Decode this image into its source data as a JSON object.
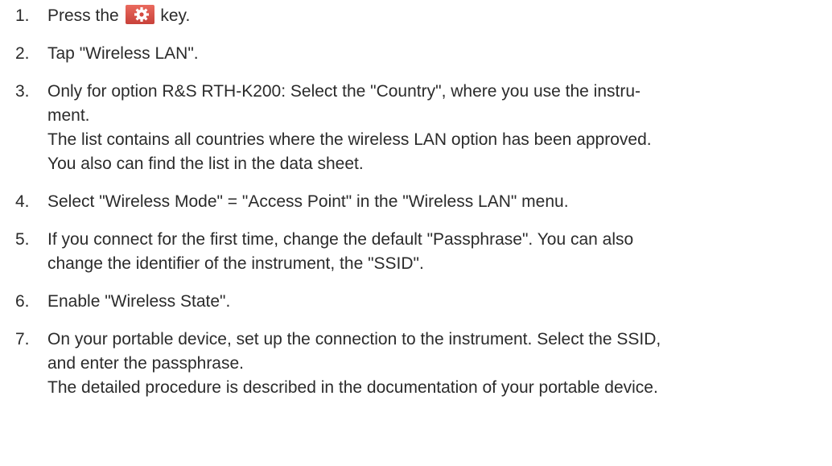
{
  "steps": [
    {
      "number": "1.",
      "lines": [],
      "before_icon": "Press the ",
      "icon": "gear-key-icon",
      "after_icon": " key."
    },
    {
      "number": "2.",
      "lines": [
        "Tap \"Wireless LAN\"."
      ]
    },
    {
      "number": "3.",
      "lines": [
        "Only for option R&S RTH-K200: Select the \"Country\", where you use the instru-",
        "ment.",
        "The list contains all countries where the wireless LAN option has been approved.",
        "You also can find the list in the data sheet."
      ]
    },
    {
      "number": "4.",
      "lines": [
        "Select \"Wireless Mode\" = \"Access Point\" in the \"Wireless LAN\" menu."
      ]
    },
    {
      "number": "5.",
      "lines": [
        "If you connect for the first time, change the default \"Passphrase\". You can also",
        "change the identifier of the instrument, the \"SSID\"."
      ]
    },
    {
      "number": "6.",
      "lines": [
        "Enable \"Wireless State\"."
      ]
    },
    {
      "number": "7.",
      "lines": [
        "On your portable device, set up the connection to the instrument. Select the SSID,",
        "and enter the passphrase.",
        "The detailed procedure is described in the documentation of your portable device."
      ]
    }
  ],
  "colors": {
    "text": "#2b2b2b",
    "key_background": "#e2574c",
    "key_symbol": "#ffffff"
  }
}
